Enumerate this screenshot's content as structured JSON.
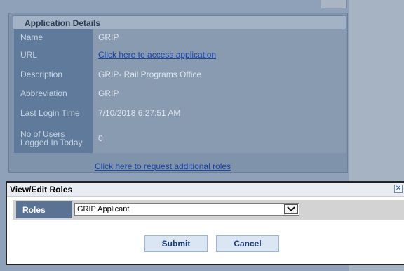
{
  "application_details": {
    "header": "Application Details",
    "rows": [
      {
        "label": "Name",
        "value": "GRIP"
      },
      {
        "label": "URL",
        "value": "Click here to access application"
      },
      {
        "label": "Description",
        "value": "GRIP- Rail Programs Office"
      },
      {
        "label": "Abbreviation",
        "value": "GRIP"
      },
      {
        "label": "Last Login Time",
        "value": "7/10/2018 6:27:51 AM"
      },
      {
        "label": "No of Users Logged In Today",
        "value": "0"
      }
    ],
    "request_roles_link": "Click here to request additional roles"
  },
  "modal": {
    "title": "View/Edit Roles",
    "close_icon": "close-icon",
    "roles_label": "Roles",
    "roles_selected": "GRIP Applicant",
    "submit_label": "Submit",
    "cancel_label": "Cancel"
  },
  "colors": {
    "link": "#1a44a8",
    "label_bg": "#5f7a9a",
    "button_bg": "#dbe6f5"
  }
}
